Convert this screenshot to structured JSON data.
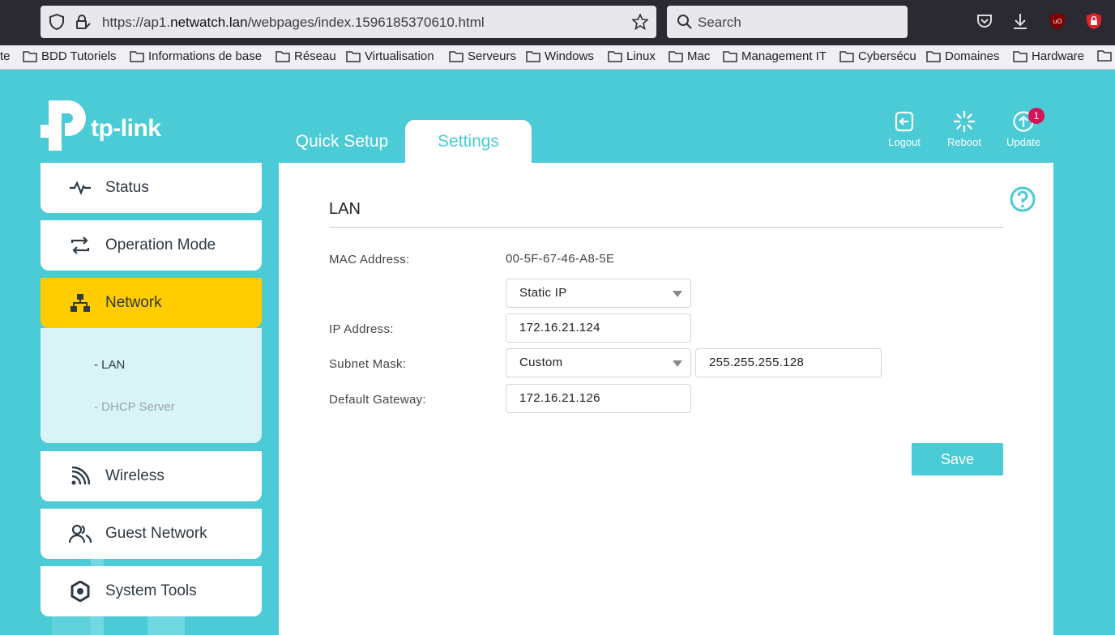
{
  "browser": {
    "url_prefix": "https://ap1.",
    "url_host": "netwatch.lan",
    "url_suffix": "/webpages/index.1596185370610.html",
    "search_placeholder": "Search",
    "bookmarks": [
      "te",
      "BDD Tutoriels",
      "Informations de base",
      "Réseau",
      "Virtualisation",
      "Serveurs",
      "Windows",
      "Linux",
      "Mac",
      "Management IT",
      "Cybersécu",
      "Domaines",
      "Hardware",
      ""
    ]
  },
  "header": {
    "logo_text": "tp-link",
    "tabs": [
      {
        "label": "Quick Setup",
        "active": false
      },
      {
        "label": "Settings",
        "active": true
      }
    ],
    "actions": [
      {
        "label": "Logout",
        "icon": "logout-icon"
      },
      {
        "label": "Reboot",
        "icon": "reboot-icon"
      },
      {
        "label": "Update",
        "icon": "update-icon",
        "badge": "1"
      }
    ]
  },
  "sidebar": {
    "items": [
      {
        "label": "Status",
        "icon": "status-icon"
      },
      {
        "label": "Operation Mode",
        "icon": "operation-mode-icon"
      },
      {
        "label": "Network",
        "icon": "network-icon",
        "active": true
      },
      {
        "label": "Wireless",
        "icon": "wireless-icon"
      },
      {
        "label": "Guest Network",
        "icon": "guest-network-icon"
      },
      {
        "label": "System Tools",
        "icon": "system-tools-icon"
      }
    ],
    "subitems": [
      {
        "label": "-  LAN",
        "current": true
      },
      {
        "label": "-  DHCP Server",
        "current": false
      }
    ]
  },
  "lan": {
    "title": "LAN",
    "mac_label": "MAC Address:",
    "mac_value": "00-5F-67-46-A8-5E",
    "ip_mode": "Static IP",
    "ip_label": "IP Address:",
    "ip_value": "172.16.21.124",
    "subnet_label": "Subnet Mask:",
    "subnet_mode": "Custom",
    "subnet_value": "255.255.255.128",
    "gateway_label": "Default Gateway:",
    "gateway_value": "172.16.21.126",
    "save_label": "Save"
  },
  "colors": {
    "brand": "#4acbd6",
    "active_nav": "#ffcc00",
    "badge": "#d3145a"
  }
}
